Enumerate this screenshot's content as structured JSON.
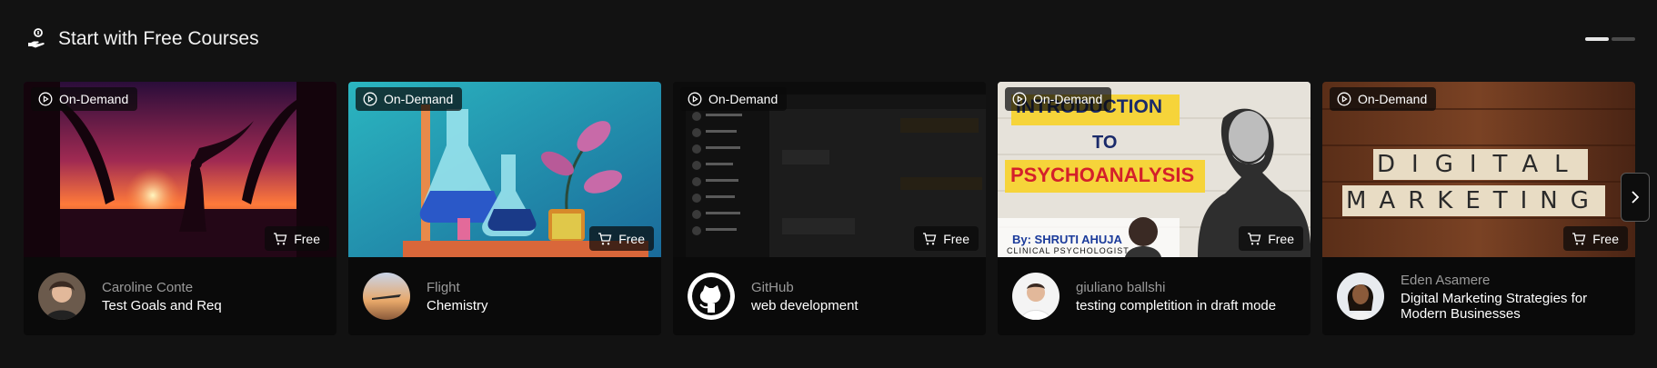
{
  "section": {
    "title": "Start with Free Courses",
    "icon": "hand-coin-icon"
  },
  "pager": {
    "pages": 2,
    "active": 1
  },
  "cards": [
    {
      "badge": "On-Demand",
      "price": "Free",
      "author": "Caroline Conte",
      "course": "Test Goals and Req"
    },
    {
      "badge": "On-Demand",
      "price": "Free",
      "author": "Flight",
      "course": "Chemistry"
    },
    {
      "badge": "On-Demand",
      "price": "Free",
      "author": "GitHub",
      "course": "web development"
    },
    {
      "badge": "On-Demand",
      "price": "Free",
      "author": "giuliano ballshi",
      "course": "testing completition in draft mode",
      "thumb_text": {
        "line1": "INTRODUCTION",
        "line2": "TO",
        "line3": "PSYCHOANALYSIS",
        "byline": "By: SHRUTI AHUJA",
        "role": "CLINICAL PSYCHOLOGIST"
      }
    },
    {
      "badge": "On-Demand",
      "price": "Free",
      "author": "Eden Asamere",
      "course": "Digital Marketing Strategies for Modern Businesses",
      "thumb_text": {
        "word1": "DIGITAL",
        "word2": "MARKETING"
      }
    }
  ],
  "icons": {
    "badge": "play-circle-icon",
    "price": "cart-icon",
    "next": "chevron-right-icon"
  },
  "colors": {
    "background": "#121212",
    "card": "#0a0a0a",
    "muted_text": "#9a9a9a",
    "psycho_yellow": "#f6d43a",
    "psycho_red": "#d4202a"
  }
}
